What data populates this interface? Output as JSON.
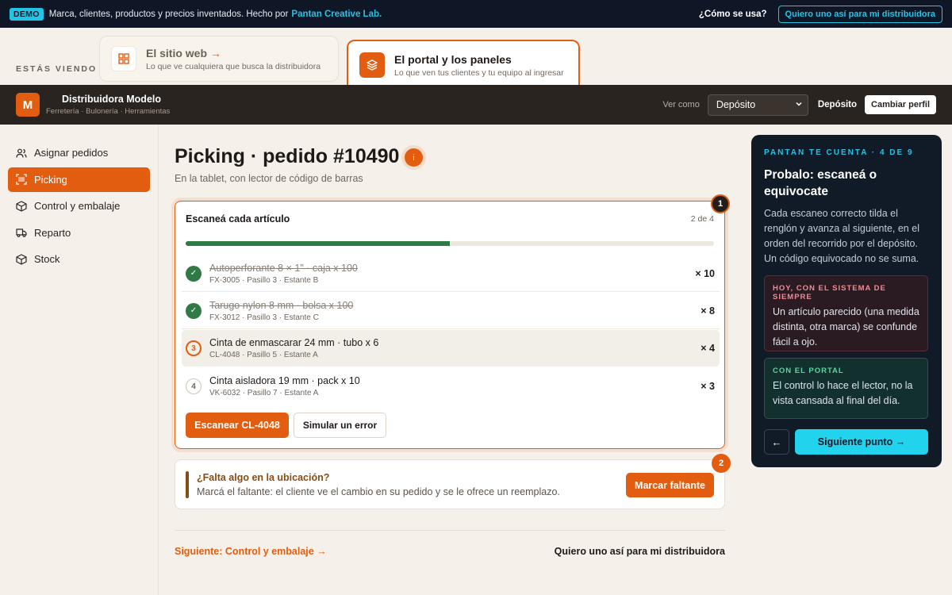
{
  "demo_bar": {
    "badge": "DEMO",
    "text": "Marca, clientes, productos y precios inventados. Hecho por",
    "lab": "Pantan Creative Lab.",
    "how": "¿Cómo se usa?",
    "want": "Quiero uno así para mi distribuidora"
  },
  "view_switch": {
    "label": "ESTÁS VIENDO",
    "tabs": [
      {
        "title": "El sitio web",
        "arrow": "→",
        "subtitle": "Lo que ve cualquiera que busca la distribuidora",
        "icon": "grid-icon"
      },
      {
        "title": "El portal y los paneles",
        "subtitle": "Lo que ven tus clientes y tu equipo al ingresar",
        "icon": "layers-icon"
      }
    ]
  },
  "app_header": {
    "logo": "M",
    "brand": "Distribuidora Modelo",
    "tagline": "Ferretería · Bulonería · Herramientas",
    "view_as": "Ver como",
    "selected_role": "Depósito",
    "role_label": "Depósito",
    "change_profile": "Cambiar perfil"
  },
  "sidebar": {
    "items": [
      {
        "label": "Asignar pedidos",
        "icon": "users-icon"
      },
      {
        "label": "Picking",
        "icon": "scan-icon"
      },
      {
        "label": "Control y embalaje",
        "icon": "box-icon"
      },
      {
        "label": "Reparto",
        "icon": "truck-icon"
      },
      {
        "label": "Stock",
        "icon": "cube-icon"
      }
    ]
  },
  "page": {
    "title": "Picking · pedido #10490",
    "info": "i",
    "subtitle": "En la tablet, con lector de código de barras"
  },
  "scan_card": {
    "step": "1",
    "heading": "Escaneá cada artículo",
    "count": "2 de 4",
    "progress": 0.5,
    "items": [
      {
        "mark": "✓",
        "name": "Autoperforante 8 × 1\" · caja x 100",
        "meta": "FX-3005 · Pasillo 3 · Estante B",
        "qty": "× 10"
      },
      {
        "mark": "✓",
        "name": "Tarugo nylon 8 mm · bolsa x 100",
        "meta": "FX-3012 · Pasillo 3 · Estante C",
        "qty": "× 8"
      },
      {
        "mark": "3",
        "name": "Cinta de enmascarar 24 mm · tubo x 6",
        "meta": "CL-4048 · Pasillo 5 · Estante A",
        "qty": "× 4"
      },
      {
        "mark": "4",
        "name": "Cinta aisladora 19 mm · pack x 10",
        "meta": "VK-6032 · Pasillo 7 · Estante A",
        "qty": "× 3"
      }
    ],
    "scan_button": "Escanear CL-4048",
    "error_button": "Simular un error"
  },
  "missing_card": {
    "step": "2",
    "question": "¿Falta algo en la ubicación?",
    "description": "Marcá el faltante: el cliente ve el cambio en su pedido y se le ofrece un reemplazo.",
    "button": "Marcar faltante"
  },
  "footer": {
    "next": "Siguiente: Control y embalaje →",
    "want": "Quiero uno así para mi distribuidora"
  },
  "guide": {
    "kicker": "PANTAN TE CUENTA · 4 DE 9",
    "title": "Probalo: escaneá o equivocate",
    "body": "Cada escaneo correcto tilda el renglón y avanza al siguiente, en el orden del recorrido por el depósito. Un código equivocado no se suma.",
    "box_old": {
      "kicker": "HOY, CON EL SISTEMA DE SIEMPRE",
      "text": "Un artículo parecido (una medida distinta, otra marca) se confunde fácil a ojo."
    },
    "box_new": {
      "kicker": "CON EL PORTAL",
      "text": "El control lo hace el lector, no la vista cansada al final del día."
    },
    "back": "←",
    "next": "Siguiente punto →"
  },
  "colors": {
    "accent": "#e35d10",
    "success": "#2f7a45",
    "guide_bg": "#111a27",
    "cyan": "#22c4e6"
  }
}
